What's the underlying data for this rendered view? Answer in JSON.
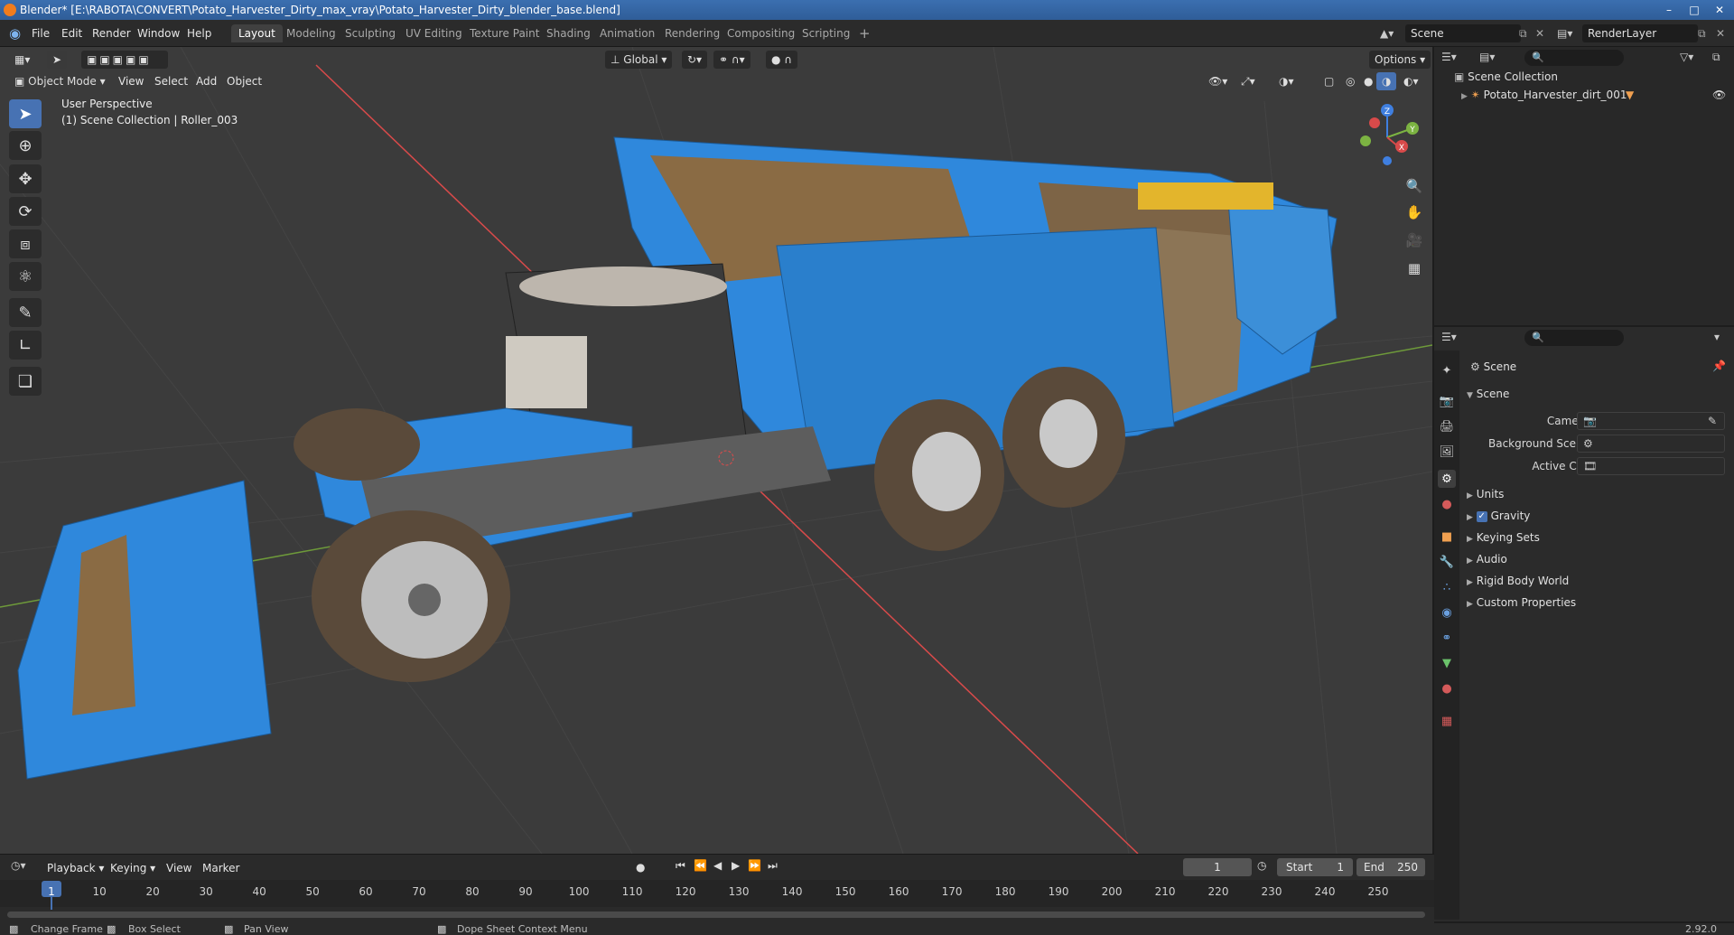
{
  "window": {
    "title": "Blender* [E:\\RABOTA\\CONVERT\\Potato_Harvester_Dirty_max_vray\\Potato_Harvester_Dirty_blender_base.blend]"
  },
  "menu": [
    "File",
    "Edit",
    "Render",
    "Window",
    "Help"
  ],
  "workspaces": {
    "tabs": [
      "Layout",
      "Modeling",
      "Sculpting",
      "UV Editing",
      "Texture Paint",
      "Shading",
      "Animation",
      "Rendering",
      "Compositing",
      "Scripting"
    ],
    "active": "Layout",
    "add": "+"
  },
  "scene_field": "Scene",
  "view_layer_field": "RenderLayer",
  "viewport": {
    "mode": "Object Mode",
    "menus": [
      "View",
      "Select",
      "Add",
      "Object"
    ],
    "transform_orientation": "Global",
    "options_label": "Options",
    "overlay_line1": "User Perspective",
    "overlay_line2": "(1) Scene Collection | Roller_003",
    "gizmo_axes": [
      "X",
      "Y",
      "Z"
    ]
  },
  "outliner": {
    "root": "Scene Collection",
    "items": [
      {
        "label": "Potato_Harvester_dirt_001"
      }
    ]
  },
  "properties": {
    "context_title": "Scene",
    "panel_title": "Scene",
    "fields": [
      {
        "label": "Camera"
      },
      {
        "label": "Background Scene"
      },
      {
        "label": "Active Clip"
      }
    ],
    "subpanels": [
      "Units",
      "Gravity",
      "Keying Sets",
      "Audio",
      "Rigid Body World",
      "Custom Properties"
    ],
    "gravity_checked": true
  },
  "timeline": {
    "menus": [
      "Playback",
      "Keying",
      "View",
      "Marker"
    ],
    "current_frame": "1",
    "start_label": "Start",
    "start": "1",
    "end_label": "End",
    "end": "250",
    "ticks": [
      "1",
      "10",
      "20",
      "30",
      "40",
      "50",
      "60",
      "70",
      "80",
      "90",
      "100",
      "110",
      "120",
      "130",
      "140",
      "150",
      "160",
      "170",
      "180",
      "190",
      "200",
      "210",
      "220",
      "230",
      "240",
      "250"
    ]
  },
  "statusbar": {
    "items": [
      "Change Frame",
      "Box Select",
      "Pan View",
      "Dope Sheet Context Menu"
    ],
    "version": "2.92.0"
  },
  "colors": {
    "accent": "#4772b3",
    "viewport_bg": "#3b3b3b",
    "machine_blue": "#2a86d8",
    "axis_x": "#d84a4a",
    "axis_y": "#7cb342",
    "axis_z": "#3f7fe0"
  }
}
